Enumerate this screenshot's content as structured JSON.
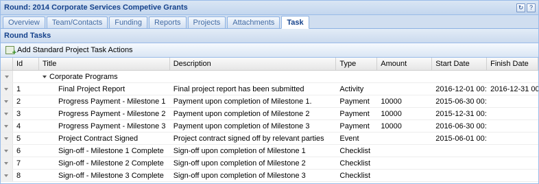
{
  "window": {
    "title": "Round: 2014 Corporate Services Competive Grants",
    "tools": [
      "refresh-icon",
      "help-icon"
    ]
  },
  "tabs": [
    {
      "label": "Overview",
      "active": false
    },
    {
      "label": "Team/Contacts",
      "active": false
    },
    {
      "label": "Funding",
      "active": false
    },
    {
      "label": "Reports",
      "active": false
    },
    {
      "label": "Projects",
      "active": false
    },
    {
      "label": "Attachments",
      "active": false
    },
    {
      "label": "Task",
      "active": true
    }
  ],
  "section": {
    "title": "Round Tasks"
  },
  "toolbar": {
    "add_label": "Add Standard Project Task Actions"
  },
  "grid": {
    "columns": [
      "Id",
      "Title",
      "Description",
      "Type",
      "Amount",
      "Start Date",
      "Finish Date"
    ],
    "group": {
      "label": "Corporate Programs"
    },
    "rows": [
      {
        "id": "1",
        "title": "Final Project Report",
        "description": "Final project report has been submitted",
        "type": "Activity",
        "amount": "",
        "start": "2016-12-01 00:0...",
        "finish": "2016-12-31 00:0..."
      },
      {
        "id": "2",
        "title": "Progress Payment - Milestone 1",
        "description": "Payment upon completion of Milestone 1.",
        "type": "Payment",
        "amount": "10000",
        "start": "2015-06-30 00:0...",
        "finish": ""
      },
      {
        "id": "3",
        "title": "Progress Payment - Milestone 2",
        "description": "Payment upon completion of Milestone 2",
        "type": "Payment",
        "amount": "10000",
        "start": "2015-12-31 00:0...",
        "finish": ""
      },
      {
        "id": "4",
        "title": "Progress Payment - Milestone 3",
        "description": "Payment upon completion of Milestone 3",
        "type": "Payment",
        "amount": "10000",
        "start": "2016-06-30 00:0...",
        "finish": ""
      },
      {
        "id": "5",
        "title": "Project Contract Signed",
        "description": "Project contract signed off by relevant parties",
        "type": "Event",
        "amount": "",
        "start": "2015-06-01 00:0...",
        "finish": ""
      },
      {
        "id": "6",
        "title": "Sign-off - Milestone 1 Complete",
        "description": "Sign-off upon completion of Milestone 1",
        "type": "Checklist",
        "amount": "",
        "start": "",
        "finish": ""
      },
      {
        "id": "7",
        "title": "Sign-off - Milestone 2 Complete",
        "description": "Sign-off upon completion of Milestone 2",
        "type": "Checklist",
        "amount": "",
        "start": "",
        "finish": ""
      },
      {
        "id": "8",
        "title": "Sign-off - Milestone 3 Complete",
        "description": "Sign-off upon completion of Milestone 3",
        "type": "Checklist",
        "amount": "",
        "start": "",
        "finish": ""
      }
    ]
  }
}
